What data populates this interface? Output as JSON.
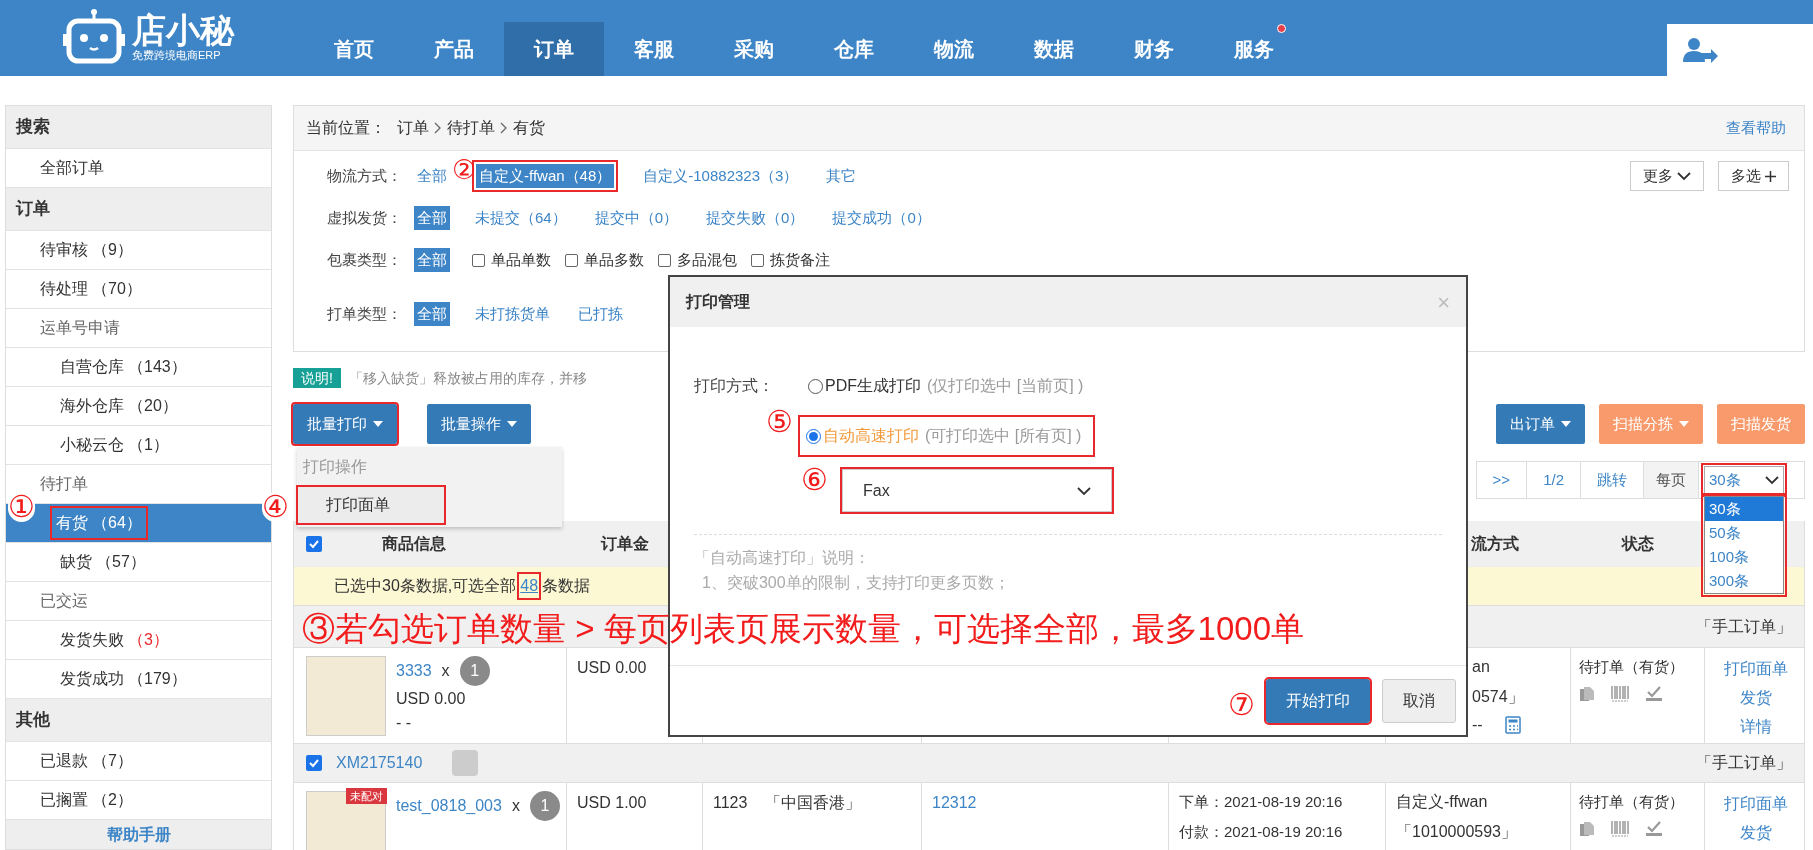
{
  "brand": {
    "name": "店小秘",
    "tagline": "免费跨境电商ERP"
  },
  "nav": [
    {
      "label": "首页",
      "selected": false,
      "notification": false
    },
    {
      "label": "产品",
      "selected": false,
      "notification": false
    },
    {
      "label": "订单",
      "selected": true,
      "notification": false
    },
    {
      "label": "客服",
      "selected": false,
      "notification": false
    },
    {
      "label": "采购",
      "selected": false,
      "notification": false
    },
    {
      "label": "仓库",
      "selected": false,
      "notification": false
    },
    {
      "label": "物流",
      "selected": false,
      "notification": false
    },
    {
      "label": "数据",
      "selected": false,
      "notification": false
    },
    {
      "label": "财务",
      "selected": false,
      "notification": false
    },
    {
      "label": "服务",
      "selected": false,
      "notification": true
    }
  ],
  "sidebar": [
    {
      "title": "搜索",
      "items": [
        {
          "label": "全部订单",
          "selected": false
        }
      ]
    },
    {
      "title": "订单",
      "items": [
        {
          "label": "待审核",
          "count": "（9）",
          "alert": false,
          "selected": false
        },
        {
          "label": "待处理",
          "count": "（70）",
          "alert": false,
          "selected": false
        },
        {
          "label": "运单号申请",
          "selected": false,
          "children": [
            {
              "label": "自营仓库",
              "count": "（143）",
              "alert": false,
              "selected": false
            },
            {
              "label": "海外仓库",
              "count": "（20）",
              "alert": false,
              "selected": false
            },
            {
              "label": "小秘云仓",
              "count": "（1）",
              "alert": false,
              "selected": false
            }
          ]
        },
        {
          "label": "待打单",
          "selected": false,
          "children": [
            {
              "label": "有货",
              "count": "（64）",
              "alert": false,
              "selected": true
            },
            {
              "label": "缺货",
              "count": "（57）",
              "alert": false,
              "selected": false
            }
          ]
        },
        {
          "label": "已交运",
          "selected": false,
          "children": [
            {
              "label": "发货失败",
              "count": "（3）",
              "alert": true,
              "selected": false
            },
            {
              "label": "发货成功",
              "count": "（179）",
              "alert": false,
              "selected": false
            }
          ]
        }
      ]
    },
    {
      "title": "其他",
      "items": [
        {
          "label": "已退款",
          "count": "（7）",
          "alert": false,
          "selected": false
        },
        {
          "label": "已搁置",
          "count": "（2）",
          "alert": false,
          "selected": false
        }
      ]
    }
  ],
  "help_link": "帮助手册",
  "breadcrumb": {
    "label": "当前位置：",
    "crumbs": [
      "订单",
      "待打单",
      "有货"
    ],
    "help": "查看帮助"
  },
  "filters": [
    {
      "label": "物流方式：",
      "options": [
        {
          "kind": "link",
          "label": "全部",
          "selected": false
        },
        {
          "kind": "link",
          "label": "自定义-ffwan（48）",
          "selected": true
        },
        {
          "kind": "link",
          "label": "自定义-10882323（3）",
          "selected": false
        },
        {
          "kind": "link",
          "label": "其它",
          "selected": false
        }
      ]
    },
    {
      "label": "虚拟发货：",
      "options": [
        {
          "kind": "link",
          "label": "全部",
          "selected": true
        },
        {
          "kind": "link",
          "label": "未提交（64）",
          "selected": false
        },
        {
          "kind": "link",
          "label": "提交中（0）",
          "selected": false
        },
        {
          "kind": "link",
          "label": "提交失败（0）",
          "selected": false
        },
        {
          "kind": "link",
          "label": "提交成功（0）",
          "selected": false
        }
      ]
    },
    {
      "label": "包裹类型：",
      "options": [
        {
          "kind": "link",
          "label": "全部",
          "selected": true
        },
        {
          "kind": "checkbox",
          "label": "单品单数",
          "checked": false
        },
        {
          "kind": "checkbox",
          "label": "单品多数",
          "checked": false
        },
        {
          "kind": "checkbox",
          "label": "多品混包",
          "checked": false
        },
        {
          "kind": "checkbox",
          "label": "拣货备注",
          "checked": false
        }
      ]
    },
    {
      "label": "打单类型：",
      "options": [
        {
          "kind": "link",
          "label": "全部",
          "selected": true
        },
        {
          "kind": "link",
          "label": "未打拣货单",
          "selected": false
        },
        {
          "kind": "link",
          "label": "已打拣",
          "selected": false
        }
      ]
    }
  ],
  "filter_buttons": [
    "更多",
    "多选"
  ],
  "notice": {
    "badge": "说明!",
    "text": "「移入缺货」释放被占用的库存，并移"
  },
  "toolbar": {
    "left": [
      "批量打印",
      "批量操作"
    ],
    "right": [
      {
        "label": "出订单",
        "color": "#337ab7",
        "caret": true
      },
      {
        "label": "扫描分拣",
        "color": "#f89a6c",
        "caret": true
      },
      {
        "label": "扫描发货",
        "color": "#f89a6c",
        "caret": false
      }
    ]
  },
  "print_menu": {
    "header": "打印操作",
    "items": [
      "打印面单"
    ]
  },
  "pagination": {
    "next": ">>",
    "page": "1/2",
    "jump": "跳转",
    "per_page_label": "每页",
    "per_page": "30条",
    "expanded": true,
    "options": [
      {
        "label": "30条",
        "selected": true
      },
      {
        "label": "50条",
        "selected": false
      },
      {
        "label": "100条",
        "selected": false
      },
      {
        "label": "300条",
        "selected": false
      }
    ]
  },
  "table": {
    "checked": true,
    "columns": [
      "商品信息",
      "订单金",
      "流方式",
      "状态"
    ],
    "selection_notice": {
      "before": "已选中30条数据,可选全部",
      "link": "48",
      "after": "条数据"
    },
    "orders": [
      {
        "source": "「手工订单」",
        "product": {
          "sku": "3333",
          "times": "x",
          "qty": "1",
          "price": "USD 0.00",
          "note": "- -"
        },
        "amount": "USD 0.00",
        "logistics": [
          "an",
          "0574」"
        ],
        "logistics_extra": "--",
        "status": "待打单（有货）",
        "actions": [
          "打印面单",
          "发货",
          "详情"
        ]
      },
      {
        "checked": true,
        "order_no": "XM2175140",
        "source": "「手工订单」",
        "product": {
          "tag": "未配对",
          "sku": "test_0818_003",
          "times": "x",
          "qty": "1"
        },
        "amount": "USD 1.00",
        "buyer": [
          "1123",
          "「中国香港」"
        ],
        "tracking": "12312",
        "dates": [
          "下单：2021-08-19 20:16",
          "付款：2021-08-19 20:16"
        ],
        "logistics": [
          "自定义-ffwan",
          "「1010000593」"
        ],
        "status": "待打单（有货）",
        "actions": [
          "打印面单",
          "发货"
        ]
      }
    ]
  },
  "dialog": {
    "title": "打印管理",
    "close": "×",
    "field_label": "打印方式：",
    "methods": [
      {
        "label": "PDF生成打印",
        "note": "(仅打印选中 [当前页] )",
        "selected": false
      },
      {
        "label": "自动高速打印",
        "note": "(可打印选中 [所有页] )",
        "selected": true
      }
    ],
    "printer": "Fax",
    "notes": [
      "「自动高速打印」说明：",
      "1、突破300单的限制，支持打印更多页数；"
    ],
    "buttons": [
      {
        "label": "开始打印",
        "primary": true
      },
      {
        "label": "取消",
        "primary": false
      }
    ]
  },
  "annotations": [
    "①",
    "②",
    "③若勾选订单数量 > 每页列表页展示数量，可选择全部，最多1000单",
    "④",
    "⑤",
    "⑥",
    "⑦"
  ]
}
